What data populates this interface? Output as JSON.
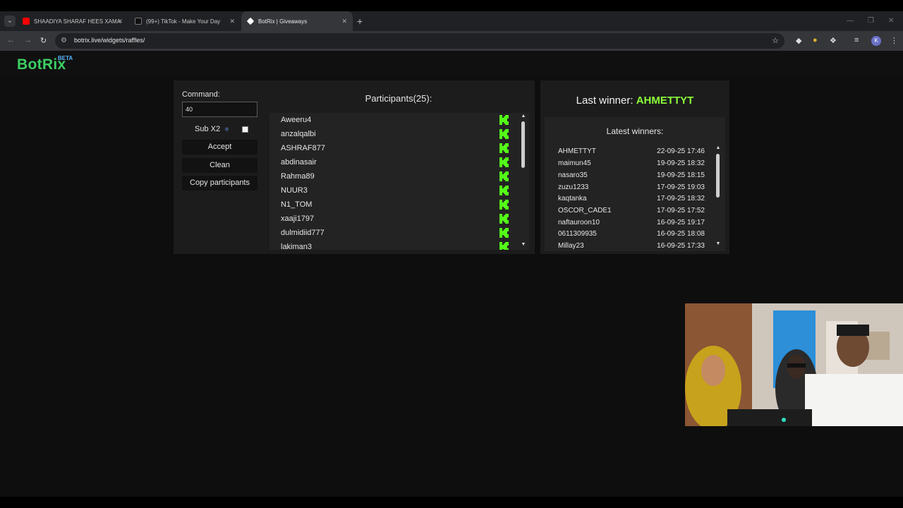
{
  "browser": {
    "tabs": [
      {
        "title": "SHAADIYA SHARAF HEES XAMA",
        "favicon_color": "#ff0000"
      },
      {
        "title": "(99+) TikTok - Make Your Day",
        "favicon_color": "#111111"
      },
      {
        "title": "BotRix | Giveaways",
        "favicon_color": "#ffffff"
      }
    ],
    "url": "botrix.live/widgets/raffles/",
    "profile_initial": "K"
  },
  "site": {
    "logo": "BotRix",
    "beta": "BETA"
  },
  "raffle": {
    "command_label": "Command:",
    "command_value": "40",
    "sub_x2_label": "Sub X2",
    "accept_label": "Accept",
    "clean_label": "Clean",
    "copy_label": "Copy participants",
    "participants_title": "Participants(25):",
    "participants": [
      "Aweeru4",
      "anzalqalbi",
      "ASHRAF877",
      "abdinasair",
      "Rahma89",
      "NUUR3",
      "N1_TOM",
      "xaaji1797",
      "dulmidiid777",
      "lakiman3"
    ]
  },
  "winners": {
    "last_winner_prefix": "Last winner:",
    "last_winner_name": "AHMETTYT",
    "latest_title": "Latest winners:",
    "list": [
      {
        "name": "AHMETTYT",
        "date": "22-09-25 17:46"
      },
      {
        "name": "maimun45",
        "date": "19-09-25 18:32"
      },
      {
        "name": "nasaro35",
        "date": "19-09-25 18:15"
      },
      {
        "name": "zuzu1233",
        "date": "17-09-25 19:03"
      },
      {
        "name": "kaqtanka",
        "date": "17-09-25 18:32"
      },
      {
        "name": "OSCOR_CADE1",
        "date": "17-09-25 17:52"
      },
      {
        "name": "naftauroon10",
        "date": "16-09-25 19:17"
      },
      {
        "name": "0611309935",
        "date": "16-09-25 18:08"
      },
      {
        "name": "Millay23",
        "date": "16-09-25 17:33"
      }
    ]
  },
  "colors": {
    "brand_green": "#3ccf65",
    "winner_green": "#8cff3a",
    "kick_green": "#53fc18"
  }
}
